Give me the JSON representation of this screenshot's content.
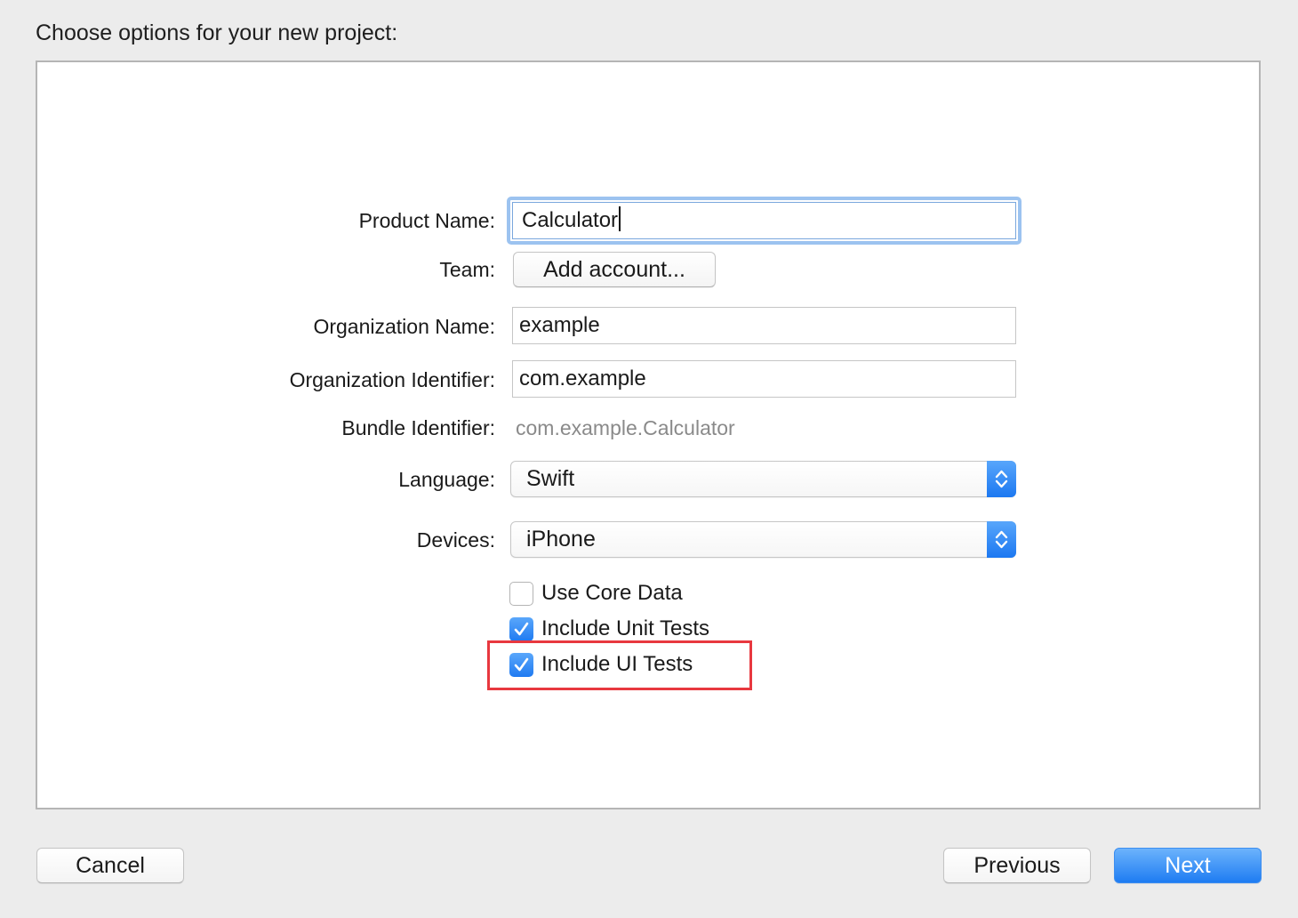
{
  "dialog": {
    "title": "Choose options for your new project:"
  },
  "form": {
    "product_name_label": "Product Name:",
    "product_name_value": "Calculator",
    "team_label": "Team:",
    "team_button": "Add account...",
    "org_name_label": "Organization Name:",
    "org_name_value": "example",
    "org_id_label": "Organization Identifier:",
    "org_id_value": "com.example",
    "bundle_id_label": "Bundle Identifier:",
    "bundle_id_value": "com.example.Calculator",
    "language_label": "Language:",
    "language_value": "Swift",
    "devices_label": "Devices:",
    "devices_value": "iPhone"
  },
  "checkboxes": [
    {
      "label": "Use Core Data",
      "checked": false
    },
    {
      "label": "Include Unit Tests",
      "checked": true
    },
    {
      "label": "Include UI Tests",
      "checked": true
    }
  ],
  "footer": {
    "cancel": "Cancel",
    "previous": "Previous",
    "next": "Next"
  },
  "colors": {
    "accent": "#1e7cf2",
    "highlight": "#e8383f",
    "focus_ring": "#9cc3f0"
  },
  "icons": {
    "popup_arrows": "up-down-chevron-icon",
    "check": "checkmark-icon"
  }
}
